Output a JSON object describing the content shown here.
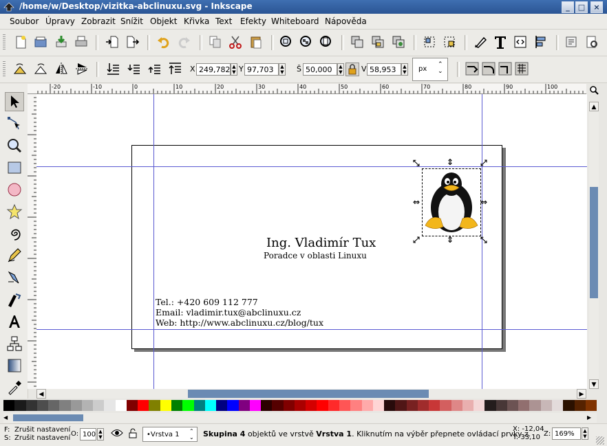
{
  "window": {
    "title": "/home/w/Desktop/vizitka-abclinuxu.svg - Inkscape"
  },
  "menu": [
    "Soubor",
    "Úpravy",
    "Zobrazit",
    "Snížit",
    "Objekt",
    "Křivka",
    "Text",
    "Efekty",
    "Whiteboard",
    "Nápověda"
  ],
  "toolbar_controls": {
    "x_label": "X",
    "x_value": "249,782",
    "y_label": "Y",
    "y_value": "97,703",
    "w_label": "Š",
    "w_value": "50,000",
    "h_label": "V",
    "h_value": "58,953",
    "unit": "px"
  },
  "ruler_labels": [
    "-20",
    "-10",
    "0",
    "10",
    "20",
    "30",
    "40",
    "50",
    "60",
    "70",
    "80",
    "90",
    "100"
  ],
  "card": {
    "name": "Ing. Vladimír Tux",
    "role": "Poradce v oblasti Linuxu",
    "phone": "Tel.: +420 609 112 777",
    "email": "Email: vladimir.tux@abclinuxu.cz",
    "web": "Web: http://www.abclinuxu.cz/blog/tux"
  },
  "palette": [
    "#000000",
    "#1a1a1a",
    "#333333",
    "#4d4d4d",
    "#666666",
    "#808080",
    "#999999",
    "#b3b3b3",
    "#cccccc",
    "#e6e6e6",
    "#ffffff",
    "#800000",
    "#ff0000",
    "#808000",
    "#ffff00",
    "#008000",
    "#00ff00",
    "#008080",
    "#00ffff",
    "#000080",
    "#0000ff",
    "#800080",
    "#ff00ff",
    "#2b0000",
    "#550000",
    "#800000",
    "#aa0000",
    "#d40000",
    "#ff0000",
    "#ff2a2a",
    "#ff5555",
    "#ff8080",
    "#ffaaaa",
    "#ffd5d5",
    "#280b0b",
    "#501616",
    "#782121",
    "#a02c2c",
    "#c83737",
    "#d35f5f",
    "#de8787",
    "#e9afaf",
    "#f4d7d7",
    "#241c1c",
    "#483737",
    "#6c5353",
    "#916f6f",
    "#ac9393",
    "#c8b7b7",
    "#e3dbdb",
    "#2b1100",
    "#552200",
    "#803300"
  ],
  "status": {
    "fill_label": "F:",
    "fill_value": "Zrušit nastavení",
    "stroke_label": "S:",
    "stroke_value": "Zrušit nastavení",
    "opacity_label": "O:",
    "opacity_value": "100",
    "layer": "•Vrstva 1",
    "message_bold1": "Skupina 4",
    "message_mid": " objektů ve vrstvě ",
    "message_bold2": "Vrstva 1",
    "message_tail": ". Kliknutím na výběr přepnete ovládací prvky z.",
    "cursor_x": "X: -12,04",
    "cursor_y": "Y: 33,10",
    "zoom_label": "Z:",
    "zoom_value": "169%"
  }
}
